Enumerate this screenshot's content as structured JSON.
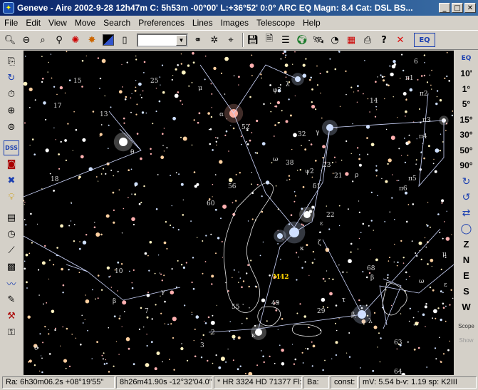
{
  "window": {
    "title": "Geneve - Aire 2002-9-28  12h47m C:  5h53m -00°00' L:+36°52' 0:0° ARC EQ Magn: 8.4 Cat: DSL BS...",
    "minimize": "_",
    "maximize": "□",
    "close": "✕"
  },
  "menu": [
    "File",
    "Edit",
    "View",
    "Move",
    "Search",
    "Preferences",
    "Lines",
    "Images",
    "Telescope",
    "Help"
  ],
  "toolbar": {
    "combo_value": "",
    "icons": [
      "zoom-in-icon",
      "zoom-out-icon",
      "zoom-area-icon",
      "search-icon",
      "target-icon",
      "star-filter-icon",
      "color-icon",
      "page-icon",
      "binoculars-icon",
      "find-star-icon",
      "marker-icon",
      "save-icon",
      "document-icon",
      "list-icon",
      "globe-icon",
      "satellite-icon",
      "gauge-icon",
      "calendar-icon",
      "printer-icon",
      "help-icon",
      "stop-icon",
      "eq-mode-icon"
    ],
    "eq_label": "EQ",
    "help_glyph": "?",
    "stop_glyph": "✕"
  },
  "left_toolbar": {
    "icons": [
      "copy-icon",
      "refresh-icon",
      "timer-icon",
      "grid-icon",
      "projection-icon",
      "dss-icon",
      "camera-icon",
      "aladin-icon",
      "bulb-icon",
      "list-panel-icon",
      "dial-icon",
      "telescope-icon",
      "calc-icon",
      "orbit-icon",
      "notes-icon",
      "tools-icon",
      "key-icon"
    ],
    "dss_label": "DSS"
  },
  "right_toolbar": {
    "fov": [
      "10'",
      "1°",
      "5°",
      "15°",
      "30°",
      "50°",
      "90°"
    ],
    "directions": [
      "Z",
      "N",
      "E",
      "S",
      "W"
    ],
    "scope_label": "Scope",
    "show_label": "Show"
  },
  "sky": {
    "labels": [
      {
        "t": "15"
      },
      {
        "t": "25"
      },
      {
        "t": "17"
      },
      {
        "t": "13"
      },
      {
        "t": "θ"
      },
      {
        "t": "18"
      },
      {
        "t": "μ"
      },
      {
        "t": "α"
      },
      {
        "t": "52"
      },
      {
        "t": "φ2"
      },
      {
        "t": "λ"
      },
      {
        "t": "14"
      },
      {
        "t": "π1"
      },
      {
        "t": "π2"
      },
      {
        "t": "6"
      },
      {
        "t": "π3"
      },
      {
        "t": "π4"
      },
      {
        "t": "γ"
      },
      {
        "t": "32"
      },
      {
        "t": "ω"
      },
      {
        "t": "38"
      },
      {
        "t": "ψ2"
      },
      {
        "t": "23"
      },
      {
        "t": "ρ"
      },
      {
        "t": "21"
      },
      {
        "t": "π5"
      },
      {
        "t": "π6"
      },
      {
        "t": "56"
      },
      {
        "t": "60"
      },
      {
        "t": "δ1"
      },
      {
        "t": "22"
      },
      {
        "t": "ε"
      },
      {
        "t": "ζ"
      },
      {
        "t": "κ"
      },
      {
        "t": "10"
      },
      {
        "t": "β"
      },
      {
        "t": "7"
      },
      {
        "t": "γ"
      },
      {
        "t": "55"
      },
      {
        "t": "49"
      },
      {
        "t": "M42"
      },
      {
        "t": "29"
      },
      {
        "t": "τ"
      },
      {
        "t": "β"
      },
      {
        "t": "λ"
      },
      {
        "t": "68"
      },
      {
        "t": "ω"
      },
      {
        "t": "β"
      },
      {
        "t": "μ"
      },
      {
        "t": "ε"
      },
      {
        "t": "2"
      },
      {
        "t": "3"
      },
      {
        "t": "θ"
      },
      {
        "t": "κ"
      },
      {
        "t": "63"
      },
      {
        "t": "64"
      }
    ],
    "star_colors": [
      "#ffffff",
      "#cfe0ff",
      "#fff2c0",
      "#ffd0a0",
      "#ffb0b0"
    ]
  },
  "status": {
    "ra": "Ra:  6h30m06.2s +08°19'55\"",
    "coord2": "8h26m41.90s -12°32'04.0\"",
    "object": "* HR 3324 HD 71377 Fl:",
    "ba": "Ba:",
    "const": "const:",
    "mag": "mV: 5.54 b-v: 1.19 sp:  K2III"
  }
}
